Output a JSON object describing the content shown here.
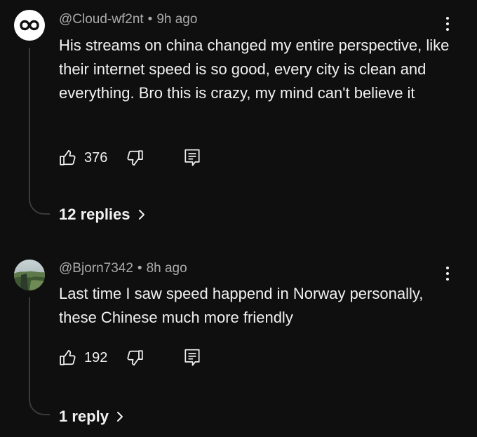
{
  "comments": [
    {
      "author": "@Cloud-wf2nt",
      "separator": "•",
      "time": "9h ago",
      "text": "His streams on china changed my entire perspective, like their internet speed is so good, every city is clean and everything. Bro this is crazy, my mind can't believe it",
      "likes": "376",
      "replies_label": "12 replies",
      "avatar_icon": "infinity-logo-icon"
    },
    {
      "author": "@Bjorn7342",
      "separator": "•",
      "time": "8h ago",
      "text": "Last time I saw speed happend in Norway personally, these Chinese much more friendly",
      "likes": "192",
      "replies_label": "1 reply",
      "avatar_icon": "landscape-photo-avatar"
    }
  ],
  "icons": {
    "like": "thumbs-up-icon",
    "dislike": "thumbs-down-icon",
    "reply": "reply-comment-icon",
    "menu": "more-vertical-icon",
    "chevron": "chevron-right-icon"
  },
  "colors": {
    "background": "#0f0f0f",
    "text_primary": "#f1f1f1",
    "text_secondary": "#aaaaaa",
    "thread_line": "#3a3a3a"
  }
}
